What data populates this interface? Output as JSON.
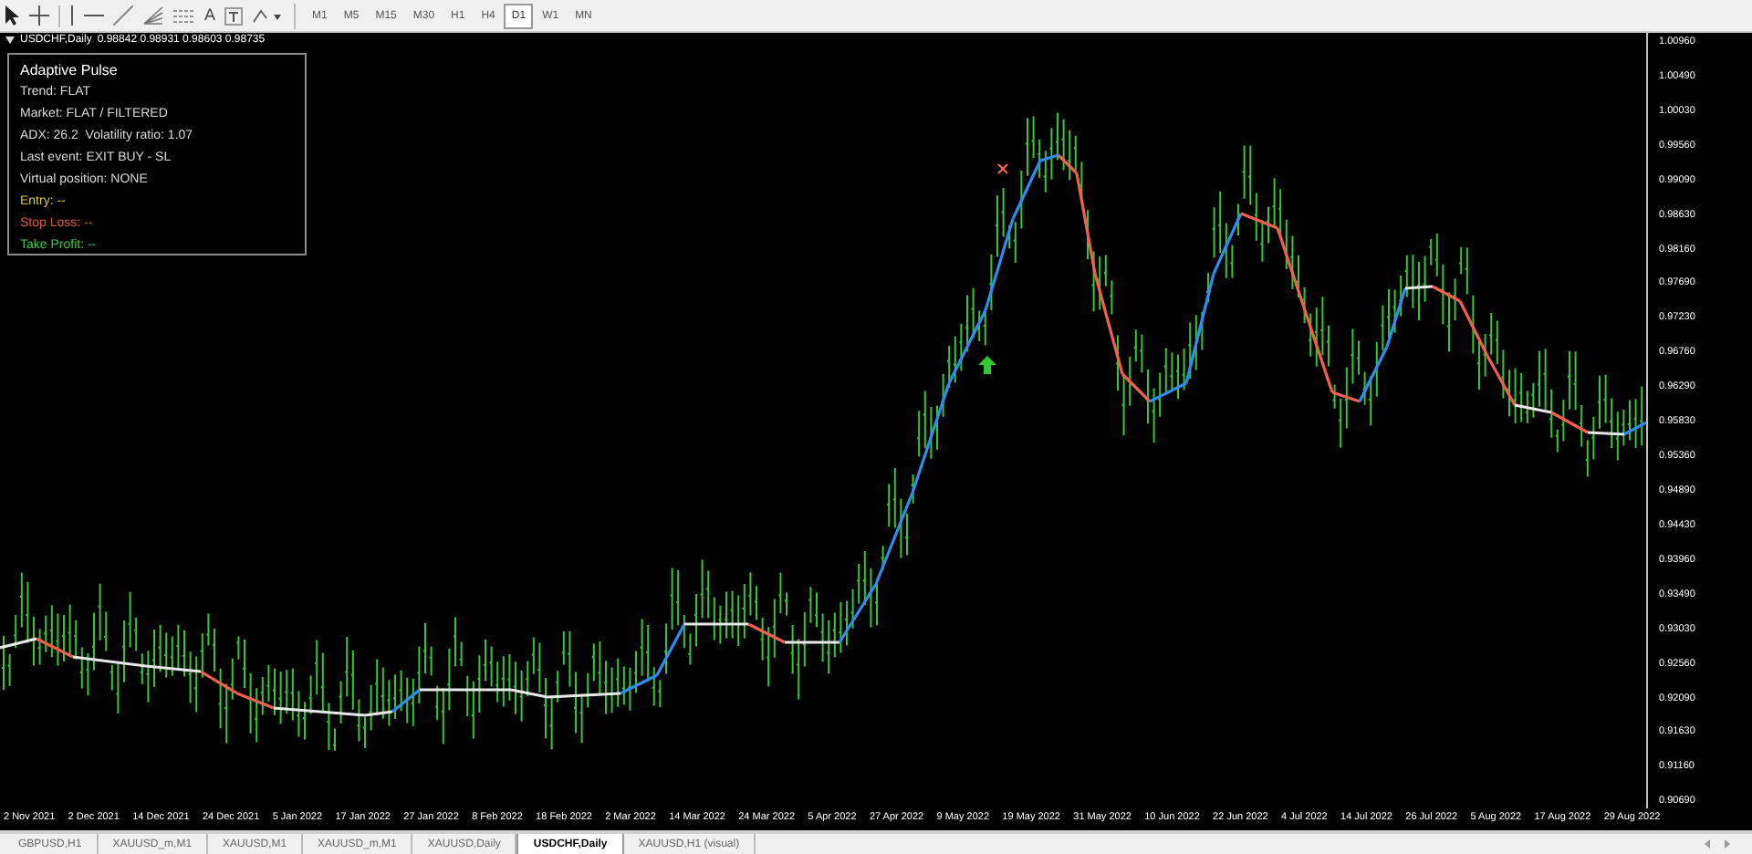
{
  "toolbar": {
    "text_tool": "A",
    "timeframes": [
      {
        "label": "M1",
        "selected": false
      },
      {
        "label": "M5",
        "selected": false
      },
      {
        "label": "M15",
        "selected": false
      },
      {
        "label": "M30",
        "selected": false
      },
      {
        "label": "H1",
        "selected": false
      },
      {
        "label": "H4",
        "selected": false
      },
      {
        "label": "D1",
        "selected": true
      },
      {
        "label": "W1",
        "selected": false
      },
      {
        "label": "MN",
        "selected": false
      }
    ]
  },
  "chart": {
    "symbol": "USDCHF,Daily",
    "quotes": "0.98842 0.98931 0.98603 0.98735",
    "info_panel": [
      {
        "text": "Adaptive Pulse",
        "color": "#ffffff"
      },
      {
        "text": "Trend: FLAT",
        "color": "#d8d8d8"
      },
      {
        "text": "Market: FLAT / FILTERED",
        "color": "#d8d8d8"
      },
      {
        "text": "ADX: 26.2  Volatility ratio: 1.07",
        "color": "#d8d8d8"
      },
      {
        "text": "Last event: EXIT BUY - SL",
        "color": "#d8d8d8"
      },
      {
        "text": "Virtual position: NONE",
        "color": "#d8d8d8"
      },
      {
        "text": "Entry: --",
        "color": "#d4c43c"
      },
      {
        "text": "Stop Loss: --",
        "color": "#e0553c"
      },
      {
        "text": "Take Profit: --",
        "color": "#3cc83c"
      }
    ],
    "price_axis": [
      "1.00960",
      "1.00490",
      "1.00030",
      "0.99560",
      "0.99090",
      "0.98630",
      "0.98160",
      "0.97690",
      "0.97230",
      "0.96760",
      "0.96290",
      "0.95830",
      "0.95360",
      "0.94890",
      "0.94430",
      "0.93960",
      "0.93490",
      "0.93030",
      "0.92560",
      "0.92090",
      "0.91630",
      "0.91160",
      "0.90690"
    ],
    "time_axis": [
      "2 Nov 2021",
      "2 Dec 2021",
      "14 Dec 2021",
      "24 Dec 2021",
      "5 Jan 2022",
      "17 Jan 2022",
      "27 Jan 2022",
      "8 Feb 2022",
      "18 Feb 2022",
      "2 Mar 2022",
      "14 Mar 2022",
      "24 Mar 2022",
      "5 Apr 2022",
      "27 Apr 2022",
      "9 May 2022",
      "19 May 2022",
      "31 May 2022",
      "10 Jun 2022",
      "22 Jun 2022",
      "4 Jul 2022",
      "14 Jul 2022",
      "26 Jul 2022",
      "5 Aug 2022",
      "17 Aug 2022",
      "29 Aug 2022"
    ]
  },
  "tabs": [
    {
      "label": "GBPUSD,H1",
      "selected": false
    },
    {
      "label": "XAUUSD_m,M1",
      "selected": false
    },
    {
      "label": "XAUUSD,M1",
      "selected": false
    },
    {
      "label": "XAUUSD_m,M1",
      "selected": false
    },
    {
      "label": "XAUUSD,Daily",
      "selected": false
    },
    {
      "label": "USDCHF,Daily",
      "selected": true
    },
    {
      "label": "XAUUSD,H1 (visual)",
      "selected": false
    }
  ]
}
